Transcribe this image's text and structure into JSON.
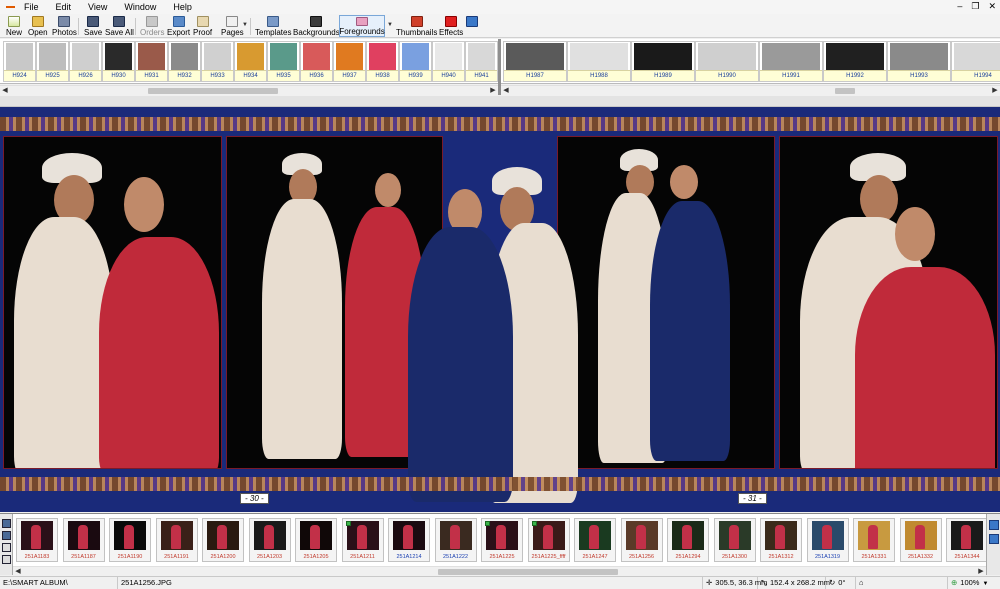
{
  "menu": [
    "File",
    "Edit",
    "View",
    "Window",
    "Help"
  ],
  "window_controls": [
    "–",
    "❐",
    "✕"
  ],
  "toolbar": {
    "new": "New",
    "open": "Open",
    "photos": "Photos",
    "save": "Save",
    "save_all": "Save All",
    "orders": "Orders",
    "export": "Export",
    "proof": "Proof",
    "pages": "Pages",
    "templates": "Templates",
    "backgrounds": "Backgrounds",
    "foregrounds": "Foregrounds",
    "thumbnails": "Thumbnails",
    "effects": "Effects"
  },
  "templates_left": [
    "H924",
    "H925",
    "H926",
    "H930",
    "H931",
    "H932",
    "H933",
    "H934",
    "H935",
    "H936",
    "H937",
    "H938",
    "H939",
    "H940",
    "H941"
  ],
  "templates_right": [
    "H1987",
    "H1988",
    "H1989",
    "H1990",
    "H1991",
    "H1992",
    "H1993",
    "H1994"
  ],
  "spread": {
    "page_left": "- 30 -",
    "page_right": "- 31 -"
  },
  "photos": [
    {
      "name": "251A1183",
      "color": "#c0392b",
      "used": false
    },
    {
      "name": "251A1187",
      "color": "#c0392b",
      "used": false
    },
    {
      "name": "251A1190",
      "color": "#c0392b",
      "used": false
    },
    {
      "name": "251A1191",
      "color": "#c0392b",
      "used": false
    },
    {
      "name": "251A1200",
      "color": "#c0392b",
      "used": false
    },
    {
      "name": "251A1203",
      "color": "#c0392b",
      "used": false
    },
    {
      "name": "251A1205",
      "color": "#c0392b",
      "used": false
    },
    {
      "name": "251A1211",
      "color": "#c0392b",
      "used": true
    },
    {
      "name": "251A1214",
      "color": "#1a3fb0",
      "used": false
    },
    {
      "name": "251A1222",
      "color": "#1a3fb0",
      "used": false
    },
    {
      "name": "251A1225",
      "color": "#c0392b",
      "used": true
    },
    {
      "name": "251A1225_ffff",
      "color": "#c0392b",
      "used": true
    },
    {
      "name": "251A1247",
      "color": "#c0392b",
      "used": false
    },
    {
      "name": "251A1256",
      "color": "#c0392b",
      "used": false
    },
    {
      "name": "251A1294",
      "color": "#c0392b",
      "used": false
    },
    {
      "name": "251A1300",
      "color": "#c0392b",
      "used": false
    },
    {
      "name": "251A1312",
      "color": "#c0392b",
      "used": false
    },
    {
      "name": "251A1319",
      "color": "#1a3fb0",
      "used": false
    },
    {
      "name": "251A1331",
      "color": "#c0392b",
      "used": false
    },
    {
      "name": "251A1332",
      "color": "#c0392b",
      "used": false
    },
    {
      "name": "251A1344",
      "color": "#c0392b",
      "used": false
    }
  ],
  "status": {
    "path": "E:\\SMART ALBUM\\",
    "file": "251A1256.JPG",
    "coords": "305.5, 36.3 mm",
    "size": "152.4 x 268.2 mm",
    "rotation": "0°",
    "zoom": "100%"
  }
}
